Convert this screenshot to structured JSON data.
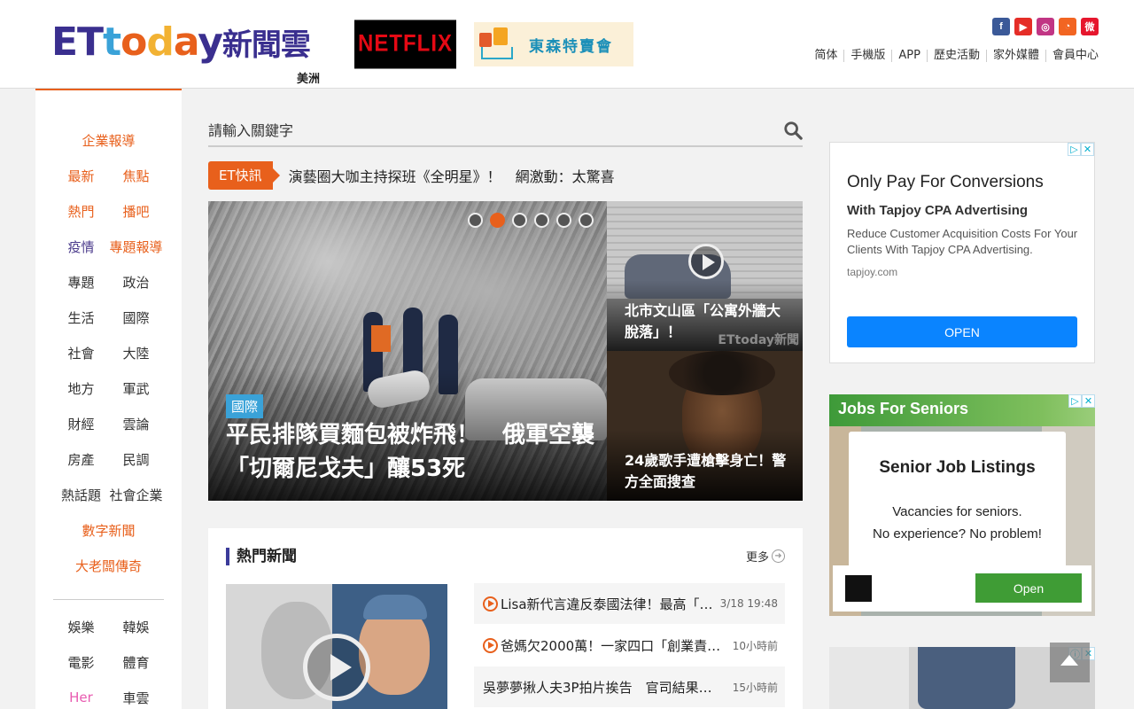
{
  "header": {
    "logo_text": "ETtoday新聞雲",
    "region": "美洲",
    "ads": {
      "netflix": "NETFLIX",
      "tosen": "東森特賣會"
    },
    "social": [
      "facebook",
      "youtube",
      "instagram",
      "rss",
      "weibo"
    ],
    "topnav": [
      "简体",
      "手機版",
      "APP",
      "歷史活動",
      "家外媒體",
      "會員中心"
    ]
  },
  "leftnav": {
    "rows": [
      [
        "企業報導"
      ],
      [
        "最新",
        "焦點"
      ],
      [
        "熱門",
        "播吧"
      ],
      [
        "疫情",
        "專題報導"
      ],
      [
        "專題",
        "政治"
      ],
      [
        "生活",
        "國際"
      ],
      [
        "社會",
        "大陸"
      ],
      [
        "地方",
        "軍武"
      ],
      [
        "財經",
        "雲論"
      ],
      [
        "房產",
        "民調"
      ],
      [
        "熱話題",
        "社會企業"
      ],
      [
        "數字新聞"
      ],
      [
        "大老闆傳奇"
      ]
    ],
    "rows2": [
      [
        "娛樂",
        "韓娛"
      ],
      [
        "電影",
        "體育"
      ],
      [
        "Her",
        "車雲"
      ]
    ]
  },
  "search": {
    "placeholder": "請輸入關鍵字"
  },
  "flash": {
    "tag": "ET快訊",
    "text": "演藝圈大咖主持探班《全明星》！　網激動：太驚喜"
  },
  "hero": {
    "category": "國際",
    "title": "平民排隊買麵包被炸飛！　俄軍空襲「切爾尼戈夫」釀53死",
    "slides": 6,
    "active_slide": 2
  },
  "side_stories": [
    {
      "title": "北市文山區「公寓外牆大脫落」！",
      "watermark": "ETtoday新聞"
    },
    {
      "title": "24歲歌手遭槍擊身亡！警方全面搜查"
    }
  ],
  "hot_news": {
    "heading": "熱門新聞",
    "more": "更多",
    "items": [
      {
        "title": "Lisa新代言違反泰國法律！最高「…",
        "time": "3/18 19:48",
        "video": true
      },
      {
        "title": "爸媽欠2000萬！一家四口「創業責…",
        "time": "10小時前",
        "video": true
      },
      {
        "title": "吳夢夢揪人夫3P拍片挨告　官司結果…",
        "time": "15小時前",
        "video": false
      }
    ]
  },
  "ads_right": {
    "ad1": {
      "headline": "Only Pay For Conversions",
      "sub": "With Tapjoy CPA Advertising",
      "desc": "Reduce Customer Acquisition Costs For Your Clients With Tapjoy CPA Advertising.",
      "url": "tapjoy.com",
      "button": "OPEN"
    },
    "ad2": {
      "banner": "Jobs For Seniors",
      "title": "Senior Job Listings",
      "line1": "Vacancies for seniors.",
      "line2": "No experience? No problem!",
      "button": "Open"
    }
  },
  "colors": {
    "accent": "#e8601c",
    "brand_purple": "#4b3b8c",
    "flash_orange": "#e8601c"
  }
}
